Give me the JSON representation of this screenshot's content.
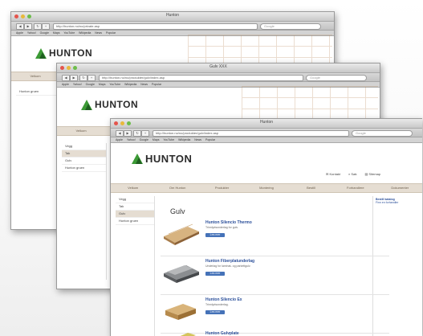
{
  "back_window": {
    "title": "Hunton",
    "address": "http://hunton.no/no/private.asp",
    "search": "Google",
    "bookmarks": "Apple Yahoo! Google Maps YouTube Wikipedia News Popular",
    "logo": "HUNTON",
    "nav_label": "Velkom",
    "sidebar": [
      "Hunton gruen"
    ]
  },
  "middle_window": {
    "title": "Gulv XXX",
    "address": "http://hunton.no/no/produkter/gulv/index.asp",
    "search": "Google",
    "bookmarks": "Apple Yahoo! Google Maps YouTube Wikipedia News Popular",
    "logo": "HUNTON",
    "nav_label": "Velkom",
    "sidebar": [
      "Vegg",
      "Tak",
      "Gulv",
      "Hunton gruen"
    ]
  },
  "front_window": {
    "title": "Hunton",
    "address": "http://hunton.no/no/produkter/gulv/index.asp",
    "search": "Google",
    "bookmarks": "Apple Yahoo! Google Maps YouTube Wikipedia News Popular",
    "logo": "HUNTON",
    "utility_links": [
      "Kontakt",
      "Søk",
      "Sitemap"
    ],
    "nav_items": [
      "Velkom",
      "Om Hunton",
      "Produkter",
      "Montering",
      "Bestill",
      "Forhandlere",
      "Dokumenter"
    ],
    "sidebar": [
      "Vegg",
      "Tak",
      "Gulv",
      "Hunton gruen"
    ],
    "page_heading": "Gulv",
    "right_panel": [
      "Bestill katalog",
      "Finn en forhandler"
    ],
    "products": [
      {
        "title": "Hunton Silencio Thermo",
        "desc": "Trinnlydsunderlag for gulv.",
        "button": "Les mer"
      },
      {
        "title": "Hunton Fiberplatunderlag",
        "desc": "Underlag for laminat- og parkettgulv.",
        "button": "Les mer"
      },
      {
        "title": "Hunton Silencio Ex",
        "desc": "Trinnlydsunderlag.",
        "button": "Les mer"
      },
      {
        "title": "Hunton Gulvplate",
        "desc": "",
        "button": ""
      }
    ]
  }
}
